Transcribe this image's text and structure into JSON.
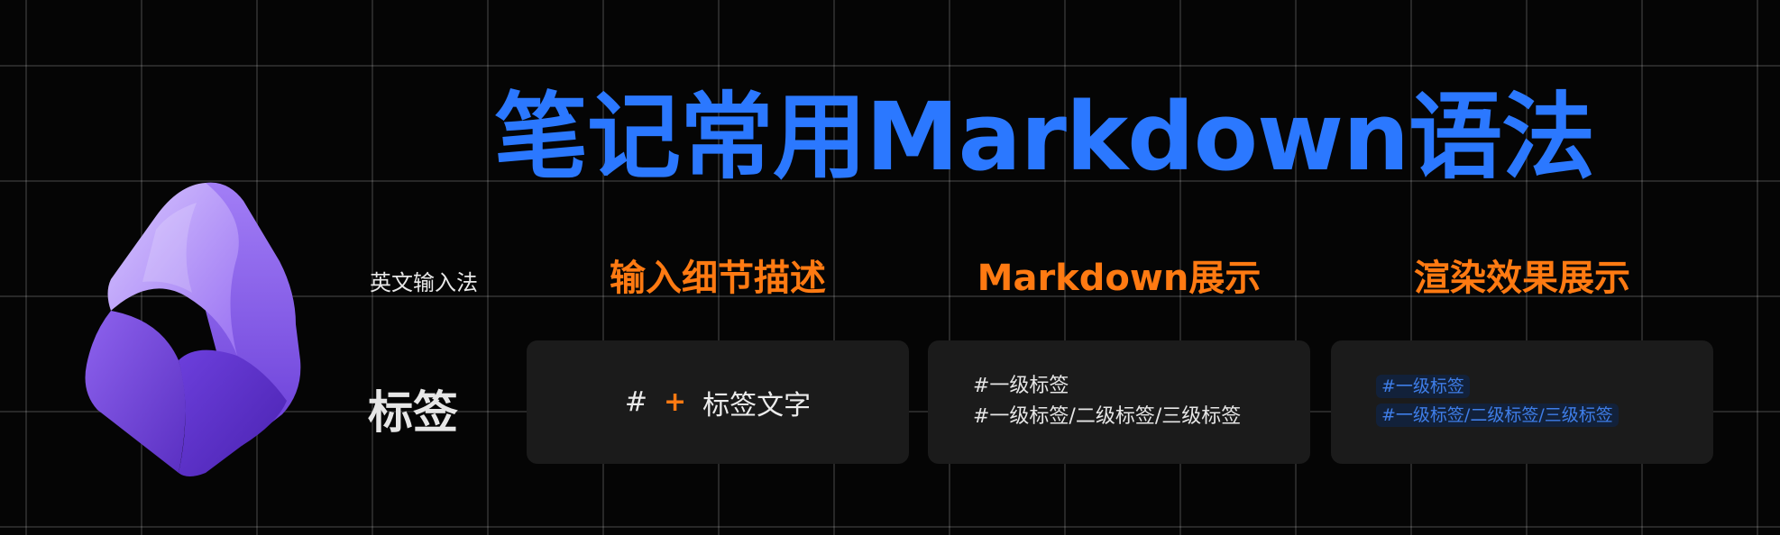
{
  "slide": {
    "title": "笔记常用Markdown语法",
    "ime_label": "英文输入法",
    "row_label": "标签"
  },
  "columns": [
    {
      "heading": "输入细节描述"
    },
    {
      "heading": "Markdown展示"
    },
    {
      "heading": "渲染效果展示"
    }
  ],
  "input_card": {
    "hash": "#",
    "plus": "+",
    "text": "标签文字"
  },
  "markdown_card": {
    "lines": [
      "#一级标签",
      "#一级标签/二级标签/三级标签"
    ]
  },
  "render_card": {
    "tags": [
      "#一级标签",
      "#一级标签/二级标签/三级标签"
    ]
  },
  "colors": {
    "title": "#2b78ff",
    "heading": "#ff7a12",
    "tag_text": "#3f7ee8",
    "logo_purple": "#7b4ae0"
  }
}
